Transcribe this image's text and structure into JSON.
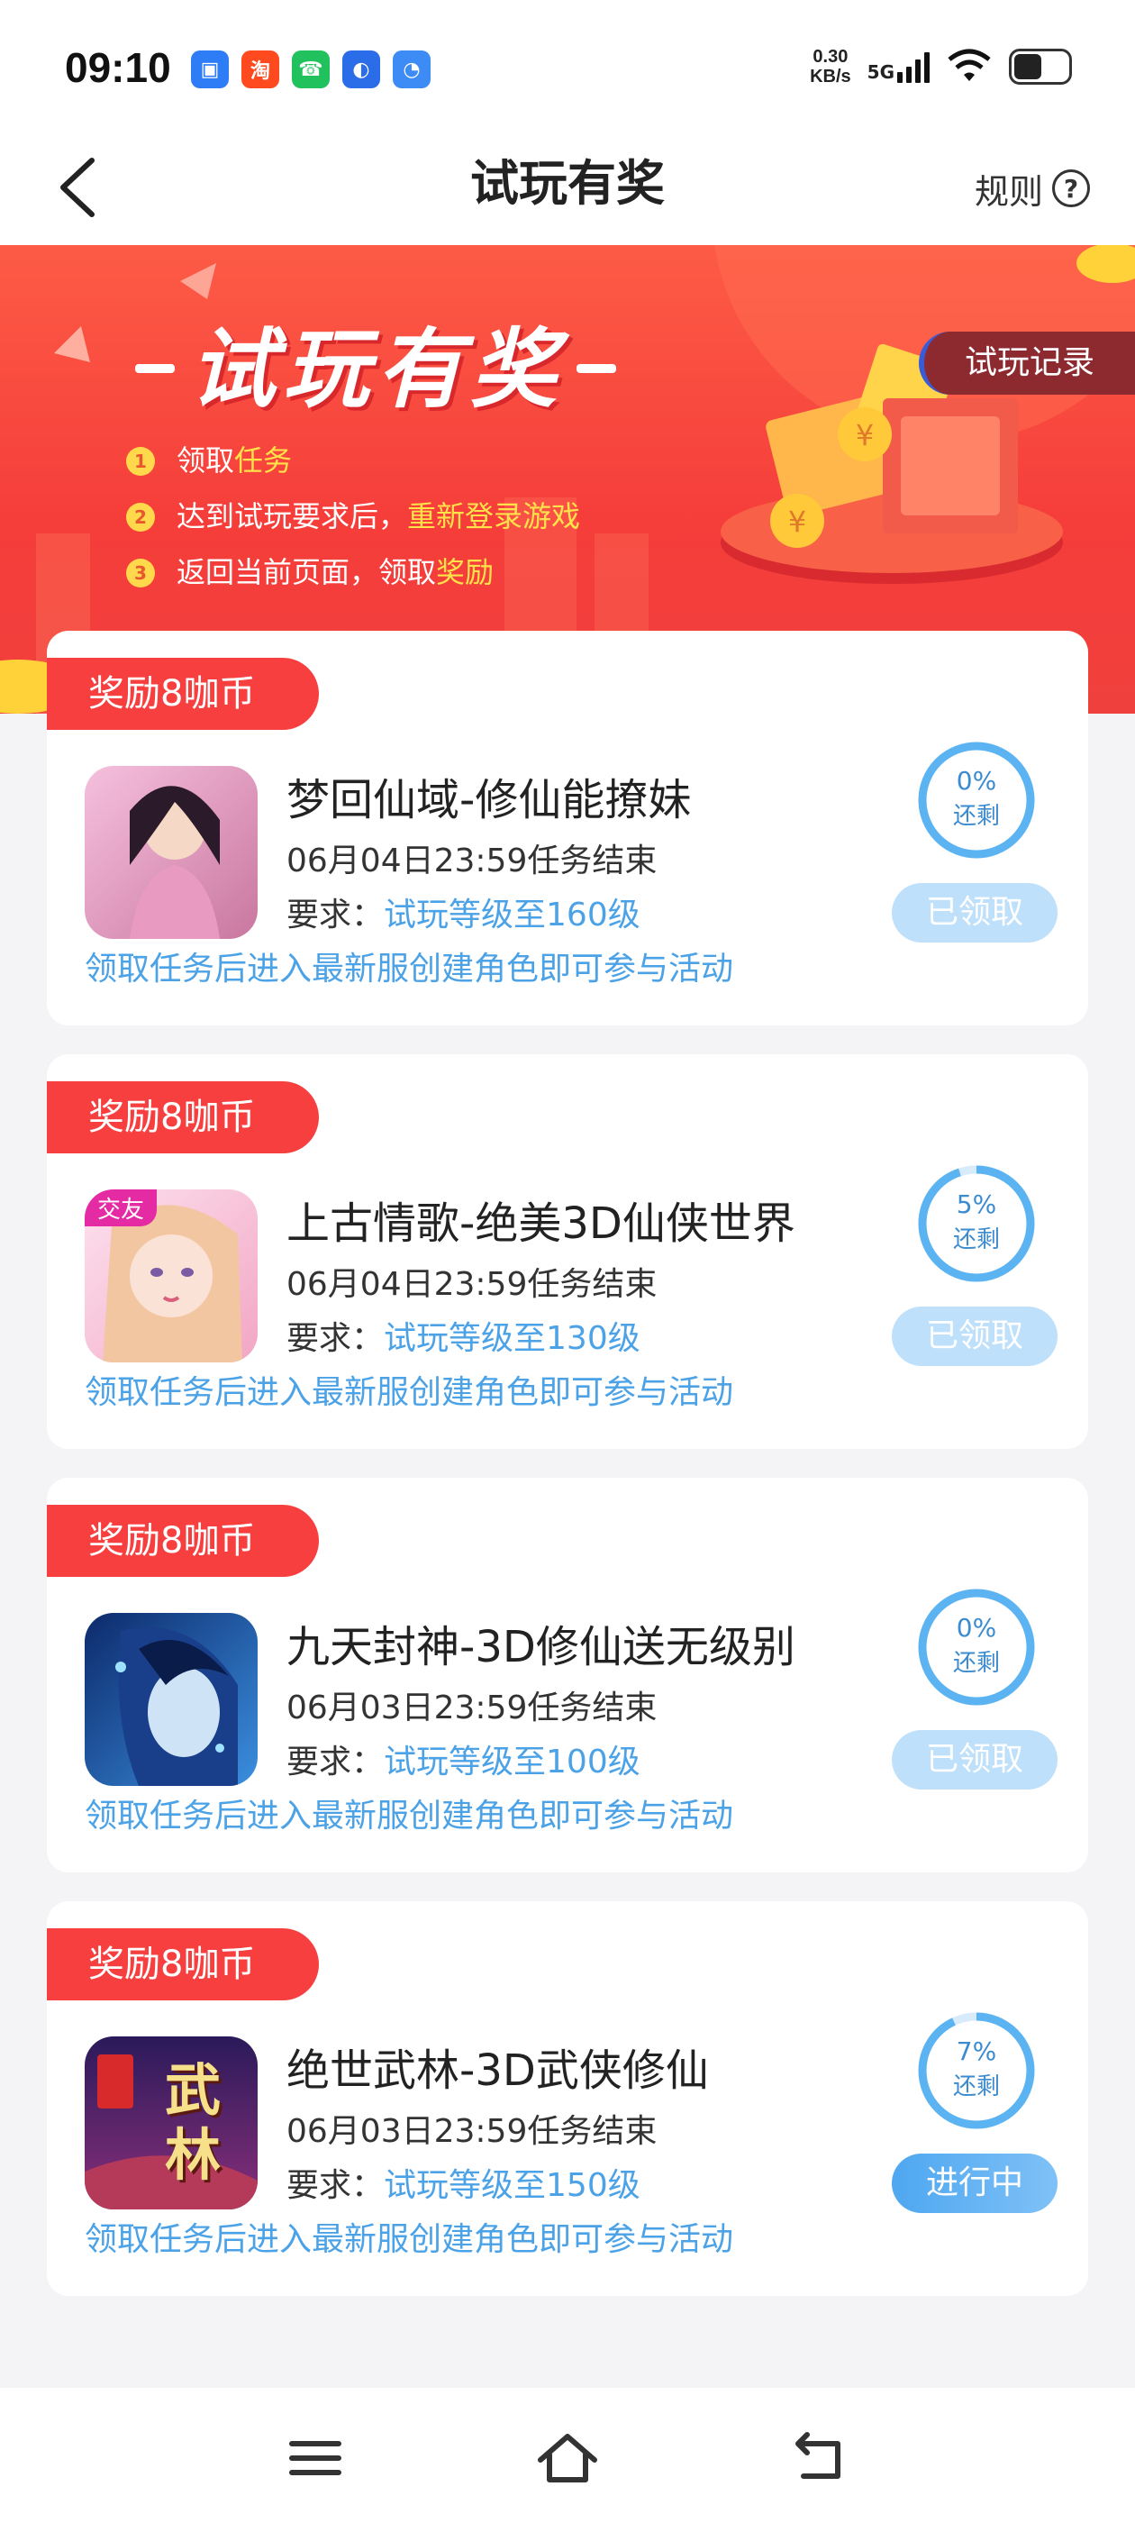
{
  "status_bar": {
    "time": "09:10",
    "net_speed": "0.30",
    "net_unit": "KB/s",
    "network": "5G",
    "apps": [
      {
        "icon": "shop-app-icon",
        "color": "#2f7df6",
        "glyph": "▣"
      },
      {
        "icon": "taobao-app-icon",
        "color": "#ff4a1f",
        "glyph": "淘"
      },
      {
        "icon": "phone-app-icon",
        "color": "#21c25e",
        "glyph": "☎"
      },
      {
        "icon": "browser-app-icon",
        "color": "#2b6de8",
        "glyph": "◐"
      },
      {
        "icon": "cloud-app-icon",
        "color": "#3d8cf5",
        "glyph": "◔"
      }
    ]
  },
  "header": {
    "title": "试玩有奖",
    "rules_label": "规则",
    "help_glyph": "?"
  },
  "banner": {
    "title": "试玩有奖",
    "record_button": "试玩记录",
    "steps": [
      {
        "num": "1",
        "text": "领取",
        "highlight": "任务"
      },
      {
        "num": "2",
        "text": "达到试玩要求后，",
        "highlight": "重新登录游戏"
      },
      {
        "num": "3",
        "text": "返回当前页面，领取",
        "highlight": "奖励"
      }
    ]
  },
  "tasks": [
    {
      "reward": "奖励8咖币",
      "title": "梦回仙域-修仙能撩妹",
      "deadline": "06月04日23:59任务结束",
      "req_label": "要求：",
      "req_value": "试玩等级至160级",
      "note": "领取任务后进入最新服创建角色即可参与活动",
      "remaining_pct": "0%",
      "remaining_value": 0,
      "remaining_label": "还剩",
      "status": "已领取",
      "status_type": "done",
      "badge": "",
      "icon": "game-icon-menghui"
    },
    {
      "reward": "奖励8咖币",
      "title": "上古情歌-绝美3D仙侠世界",
      "deadline": "06月04日23:59任务结束",
      "req_label": "要求：",
      "req_value": "试玩等级至130级",
      "note": "领取任务后进入最新服创建角色即可参与活动",
      "remaining_pct": "5%",
      "remaining_value": 5,
      "remaining_label": "还剩",
      "status": "已领取",
      "status_type": "done",
      "badge": "交友",
      "icon": "game-icon-shanggu"
    },
    {
      "reward": "奖励8咖币",
      "title": "九天封神-3D修仙送无级别",
      "deadline": "06月03日23:59任务结束",
      "req_label": "要求：",
      "req_value": "试玩等级至100级",
      "note": "领取任务后进入最新服创建角色即可参与活动",
      "remaining_pct": "0%",
      "remaining_value": 0,
      "remaining_label": "还剩",
      "status": "已领取",
      "status_type": "done",
      "badge": "",
      "icon": "game-icon-jiutian"
    },
    {
      "reward": "奖励8咖币",
      "title": "绝世武林-3D武侠修仙",
      "deadline": "06月03日23:59任务结束",
      "req_label": "要求：",
      "req_value": "试玩等级至150级",
      "note": "领取任务后进入最新服创建角色即可参与活动",
      "remaining_pct": "7%",
      "remaining_value": 7,
      "remaining_label": "还剩",
      "status": "进行中",
      "status_type": "active",
      "badge": "",
      "icon": "game-icon-jueshi",
      "icon_text": "武林"
    }
  ],
  "colors": {
    "accent": "#4ca2e6",
    "reward_tag": "#f73f3f",
    "banner": "#f5433b"
  }
}
